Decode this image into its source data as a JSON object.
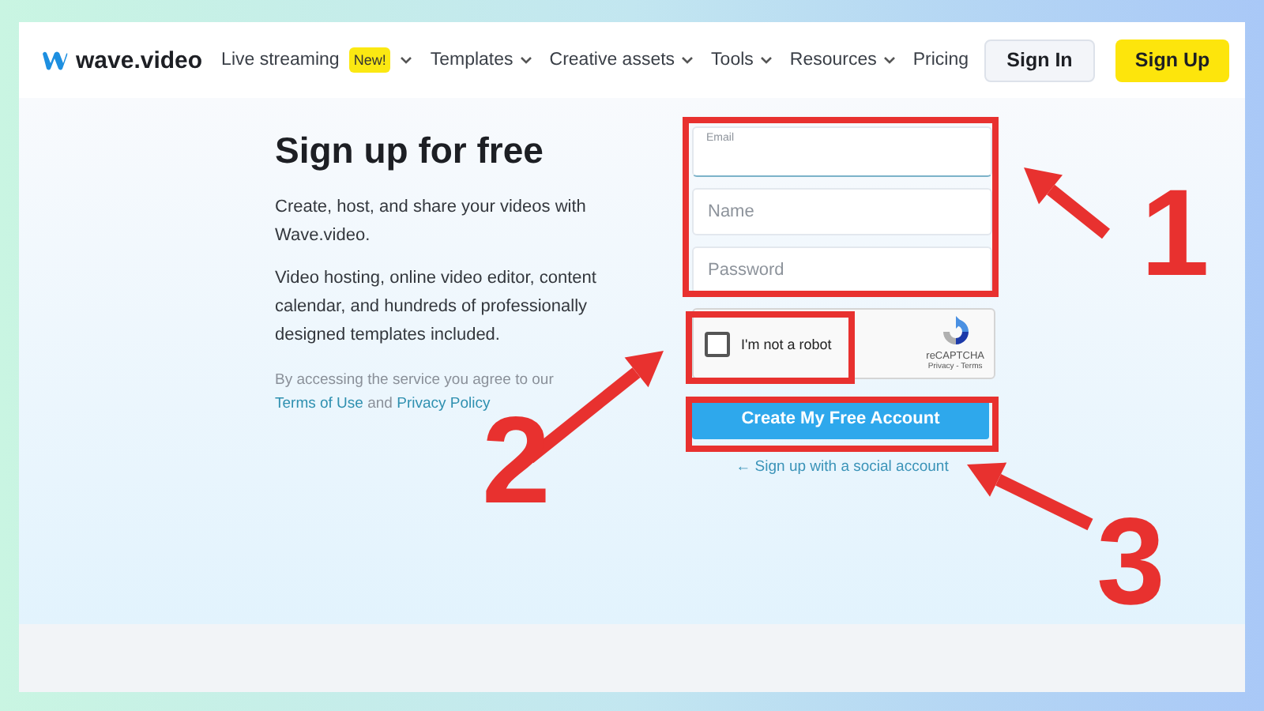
{
  "header": {
    "logo": "wave.video",
    "nav": [
      {
        "label": "Live streaming",
        "badge": "New!",
        "dropdown": true
      },
      {
        "label": "Templates",
        "dropdown": true
      },
      {
        "label": "Creative assets",
        "dropdown": true
      },
      {
        "label": "Tools",
        "dropdown": true
      },
      {
        "label": "Resources",
        "dropdown": true
      },
      {
        "label": "Pricing",
        "dropdown": false
      }
    ],
    "sign_in": "Sign In",
    "sign_up": "Sign Up"
  },
  "intro": {
    "title": "Sign up for free",
    "paragraphs": [
      "Create, host, and share your videos with Wave.video.",
      "Video hosting, online video editor, content calendar, and hundreds of professionally designed templates included."
    ],
    "legal": {
      "text": "By accessing the service you agree to our",
      "terms": "Terms of Use",
      "and": "and",
      "privacy": "Privacy Policy"
    }
  },
  "form": {
    "email": {
      "label": "Email"
    },
    "name": {
      "placeholder": "Name"
    },
    "password": {
      "placeholder": "Password"
    },
    "captcha": {
      "label": "I'm not a robot",
      "checked": false,
      "brand": "reCAPTCHA",
      "links": "Privacy - Terms"
    },
    "submit": "Create My Free Account",
    "social_link": "← Sign up with a social account"
  },
  "annotations": [
    {
      "number": "1"
    },
    {
      "number": "2"
    },
    {
      "number": "3"
    }
  ]
}
